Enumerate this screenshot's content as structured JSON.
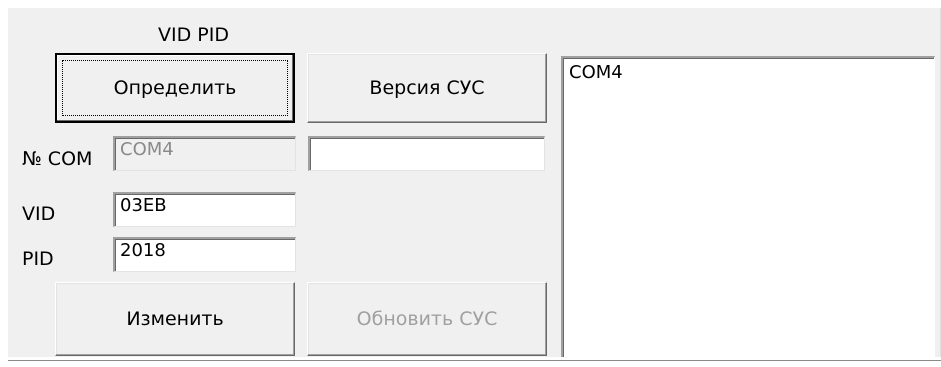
{
  "group": {
    "title": "VID PID"
  },
  "buttons": {
    "detect": "Определить",
    "version": "Версия СУС",
    "change": "Изменить",
    "update": "Обновить СУС"
  },
  "fields": {
    "com_label": "№ COM",
    "com_value": "COM4",
    "version_value": "",
    "vid_label": "VID",
    "vid_value": "03EB",
    "pid_label": "PID",
    "pid_value": "2018"
  },
  "list": {
    "items": [
      "COM4"
    ]
  }
}
